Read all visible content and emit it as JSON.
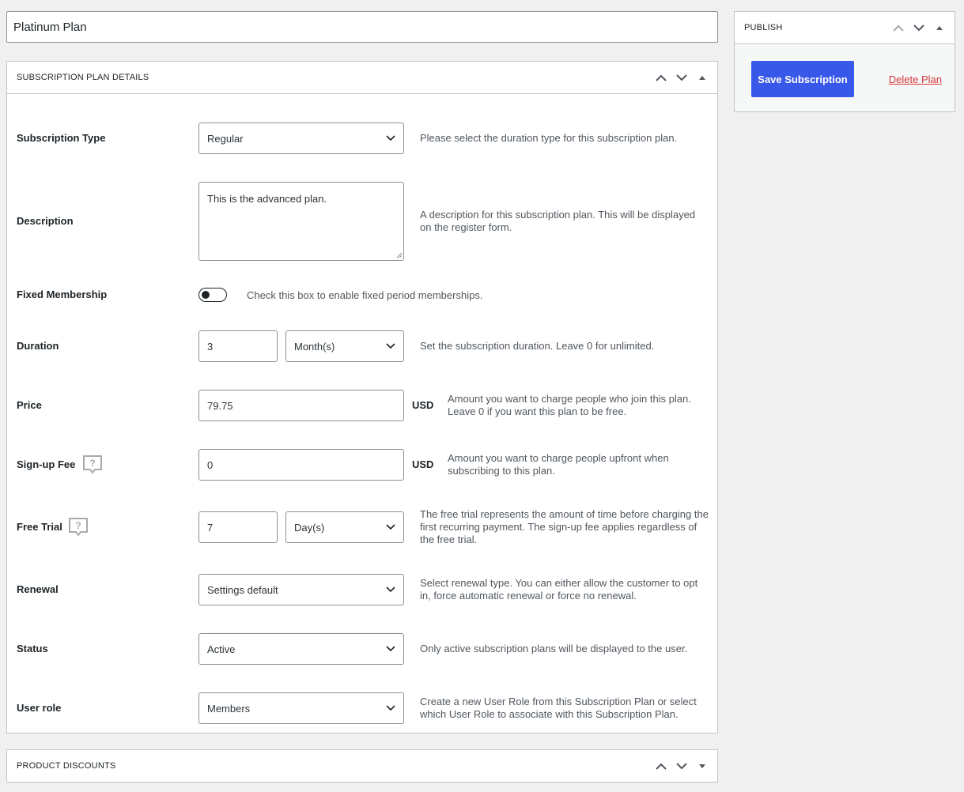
{
  "title": {
    "value": "Platinum Plan"
  },
  "details": {
    "header": "Subscription Plan Details",
    "subscription_type": {
      "label": "Subscription Type",
      "value": "Regular",
      "desc": "Please select the duration type for this subscription plan."
    },
    "description": {
      "label": "Description",
      "value": "This is the advanced plan.",
      "desc": "A description for this subscription plan. This will be displayed on the register form."
    },
    "fixed_membership": {
      "label": "Fixed Membership",
      "enabled": false,
      "desc": "Check this box to enable fixed period memberships."
    },
    "duration": {
      "label": "Duration",
      "value": "3",
      "unit": "Month(s)",
      "desc": "Set the subscription duration. Leave 0 for unlimited."
    },
    "price": {
      "label": "Price",
      "value": "79.75",
      "currency": "USD",
      "desc": "Amount you want to charge people who join this plan. Leave 0 if you want this plan to be free."
    },
    "signup_fee": {
      "label": "Sign-up Fee",
      "value": "0",
      "currency": "USD",
      "desc": "Amount you want to charge people upfront when subscribing to this plan."
    },
    "free_trial": {
      "label": "Free Trial",
      "value": "7",
      "unit": "Day(s)",
      "desc": "The free trial represents the amount of time before charging the first recurring payment. The sign-up fee applies regardless of the free trial."
    },
    "renewal": {
      "label": "Renewal",
      "value": "Settings default",
      "desc": "Select renewal type. You can either allow the customer to opt in, force automatic renewal or force no renewal."
    },
    "status": {
      "label": "Status",
      "value": "Active",
      "desc": "Only active subscription plans will be displayed to the user."
    },
    "user_role": {
      "label": "User role",
      "value": "Members",
      "desc": "Create a new User Role from this Subscription Plan or select which User Role to associate with this Subscription Plan."
    }
  },
  "discounts": {
    "header": "Product Discounts"
  },
  "publish": {
    "header": "Publish",
    "save_label": "Save Subscription",
    "delete_label": "Delete Plan"
  },
  "colors": {
    "primary": "#3858e9",
    "danger": "#d63638",
    "border": "#c3c4c7"
  }
}
